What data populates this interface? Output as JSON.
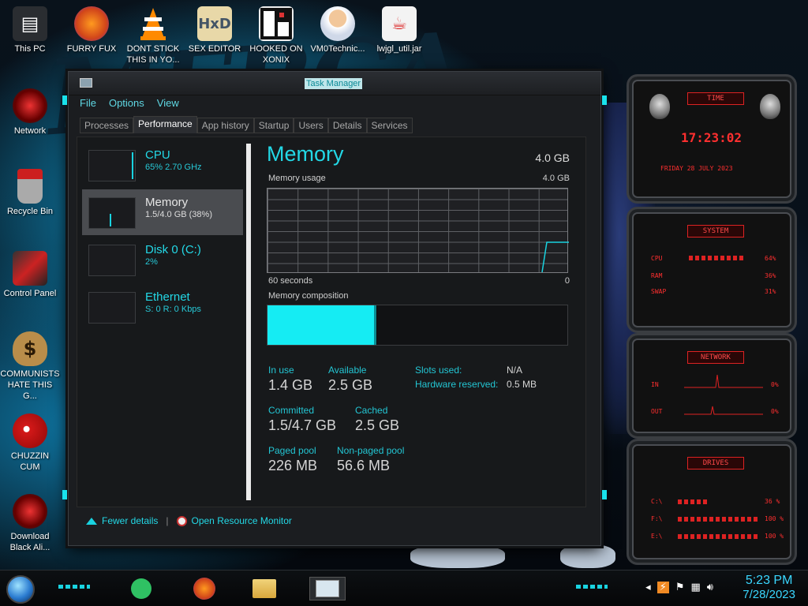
{
  "desktop_icons": [
    {
      "label": "This PC",
      "icon": "computer-icon"
    },
    {
      "label": "FURRY FUX",
      "icon": "firefox-icon"
    },
    {
      "label": "DONT STICK THIS IN YO...",
      "icon": "vlc-icon"
    },
    {
      "label": "SEX EDITOR",
      "icon": "hxd-icon"
    },
    {
      "label": "HOOKED ON XONIX",
      "icon": "game-icon"
    },
    {
      "label": "VM0Technic...",
      "icon": "doctor-icon"
    },
    {
      "label": "lwjgl_util.jar",
      "icon": "java-icon"
    },
    {
      "label": "Network",
      "icon": "network-icon"
    },
    {
      "label": "Recycle Bin",
      "icon": "recycle-bin-icon"
    },
    {
      "label": "Control Panel",
      "icon": "control-panel-icon"
    },
    {
      "label": "COMMUNISTS HATE THIS G...",
      "icon": "money-bag-icon"
    },
    {
      "label": "CHUZZIN CUM",
      "icon": "chuzzle-icon"
    },
    {
      "label": "Download Black Ali...",
      "icon": "alienware-icon"
    }
  ],
  "task_manager": {
    "title": "Task Manager",
    "menu": [
      "File",
      "Options",
      "View"
    ],
    "tabs": [
      "Processes",
      "Performance",
      "App history",
      "Startup",
      "Users",
      "Details",
      "Services"
    ],
    "active_tab": "Performance",
    "sidebar": [
      {
        "name": "CPU",
        "sub": "65%  2.70 GHz"
      },
      {
        "name": "Memory",
        "sub": "1.5/4.0 GB (38%)"
      },
      {
        "name": "Disk 0 (C:)",
        "sub": "2%"
      },
      {
        "name": "Ethernet",
        "sub": "S: 0  R: 0 Kbps"
      }
    ],
    "main": {
      "title": "Memory",
      "total": "4.0 GB",
      "usage_label": "Memory usage",
      "usage_max": "4.0 GB",
      "graph_left": "60 seconds",
      "graph_right": "0",
      "composition_label": "Memory composition",
      "composition_in_use_fraction": 0.36,
      "in_use_label": "In use",
      "in_use": "1.4 GB",
      "available_label": "Available",
      "available": "2.5 GB",
      "committed_label": "Committed",
      "committed": "1.5/4.7 GB",
      "cached_label": "Cached",
      "cached": "2.5 GB",
      "paged_label": "Paged pool",
      "paged": "226 MB",
      "nonpaged_label": "Non-paged pool",
      "nonpaged": "56.6 MB",
      "slots_label": "Slots used:",
      "slots": "N/A",
      "hw_label": "Hardware reserved:",
      "hw": "0.5 MB"
    },
    "footer": {
      "fewer": "Fewer details",
      "monitor": "Open Resource Monitor"
    }
  },
  "gadgets": {
    "time": {
      "head": "TIME",
      "clock": "17:23:02",
      "date": "FRIDAY 28 JULY 2023"
    },
    "system": {
      "head": "SYSTEM",
      "rows": [
        {
          "k": "CPU",
          "v": "64%"
        },
        {
          "k": "RAM",
          "v": "36%"
        },
        {
          "k": "SWAP",
          "v": "31%"
        }
      ]
    },
    "network": {
      "head": "NETWORK",
      "rows": [
        {
          "k": "IN",
          "v": "0%"
        },
        {
          "k": "OUT",
          "v": "0%"
        }
      ]
    },
    "drives": {
      "head": "DRIVES",
      "rows": [
        {
          "k": "C:\\",
          "v": "36 %"
        },
        {
          "k": "F:\\",
          "v": "100 %"
        },
        {
          "k": "E:\\",
          "v": "100 %"
        }
      ]
    }
  },
  "taskbar": {
    "time": "5:23 PM",
    "date": "7/28/2023",
    "pinned": [
      "notes-icon",
      "firefox-icon",
      "file-explorer-icon",
      "task-manager-icon"
    ]
  },
  "colors": {
    "accent": "#23d8e6",
    "gadget_red": "#ff2f2f"
  }
}
